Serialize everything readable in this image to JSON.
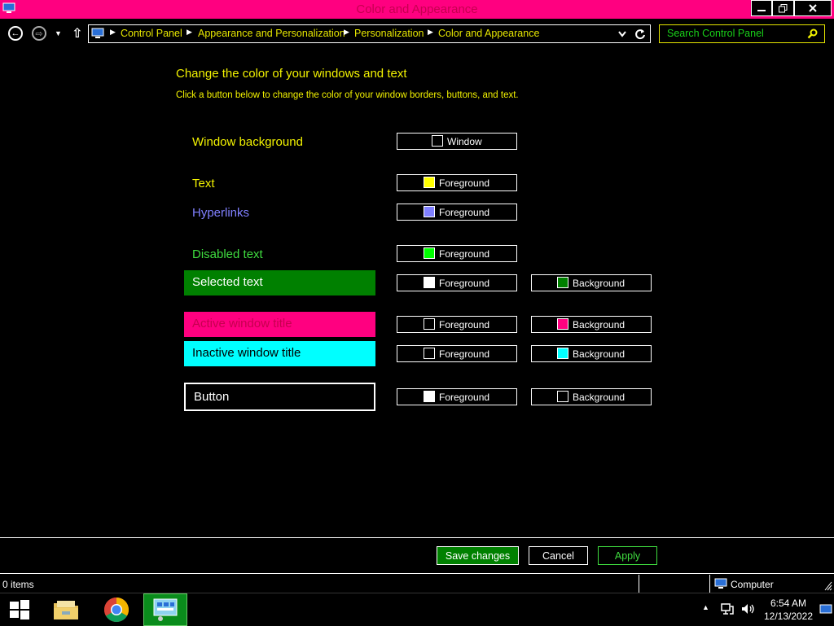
{
  "window": {
    "title": "Color and Appearance"
  },
  "nav": {
    "breadcrumbs": [
      "Control Panel",
      "Appearance and Personalization",
      "Personalization",
      "Color and Appearance"
    ],
    "search_placeholder": "Search Control Panel"
  },
  "main": {
    "heading": "Change the color of your windows and text",
    "subheading": "Click a button below to change the color of your window borders, buttons, and text.",
    "rows": [
      {
        "label": "Window background",
        "label_color": "#f2f200",
        "buttons": [
          {
            "text": "Window",
            "swatch": "#000000"
          }
        ]
      },
      {
        "label": "Text",
        "label_color": "#f2f200",
        "buttons": [
          {
            "text": "Foreground",
            "swatch": "#ffff00"
          }
        ]
      },
      {
        "label": "Hyperlinks",
        "label_color": "#8080ff",
        "buttons": [
          {
            "text": "Foreground",
            "swatch": "#8080ff"
          }
        ]
      },
      {
        "label": "Disabled text",
        "label_color": "#3fdc3f",
        "buttons": [
          {
            "text": "Foreground",
            "swatch": "#00ff00"
          }
        ]
      },
      {
        "label": "Selected text",
        "label_color": "#ffffff",
        "bar_color": "#008000",
        "buttons": [
          {
            "text": "Foreground",
            "swatch": "#ffffff"
          },
          {
            "text": "Background",
            "swatch": "#008000"
          }
        ]
      },
      {
        "label": "Active window title",
        "label_color": "#c6004f",
        "bar_color": "#ff0080",
        "buttons": [
          {
            "text": "Foreground",
            "swatch": "#000000"
          },
          {
            "text": "Background",
            "swatch": "#ff0080"
          }
        ]
      },
      {
        "label": "Inactive window title",
        "label_color": "#000000",
        "bar_color": "#00ffff",
        "buttons": [
          {
            "text": "Foreground",
            "swatch": "#000000"
          },
          {
            "text": "Background",
            "swatch": "#00ffff"
          }
        ]
      },
      {
        "label": "Button",
        "label_color": "#ffffff",
        "bar_color": "#000000",
        "bar_border": "#ffffff",
        "buttons": [
          {
            "text": "Foreground",
            "swatch": "#ffffff"
          },
          {
            "text": "Background",
            "swatch": "#000000"
          }
        ]
      }
    ]
  },
  "actions": {
    "save": "Save changes",
    "cancel": "Cancel",
    "apply": "Apply"
  },
  "status": {
    "items": "0 items",
    "location": "Computer"
  },
  "taskbar": {
    "time": "6:54 AM",
    "date": "12/13/2022"
  },
  "colors": {
    "accent": "#ff0080",
    "text": "#ffff00",
    "disabled": "#00ff00"
  }
}
